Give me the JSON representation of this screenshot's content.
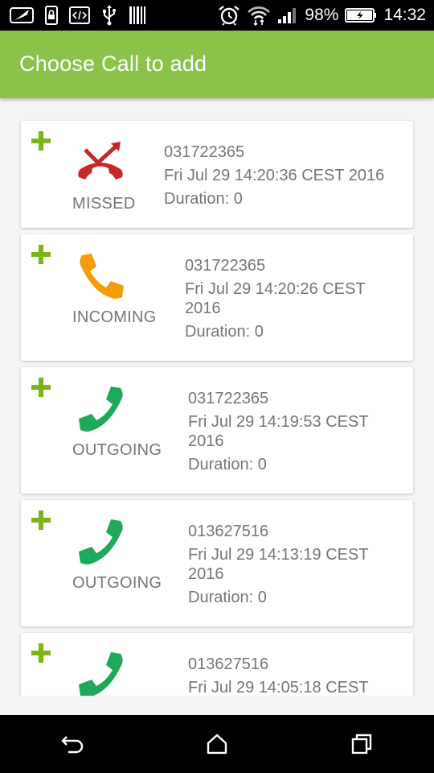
{
  "status_bar": {
    "battery": "98%",
    "time": "14:32"
  },
  "app_bar": {
    "title": "Choose Call to add"
  },
  "colors": {
    "app_bar": "#8bc34a",
    "add": "#7cb518",
    "missed": "#c62828",
    "incoming": "#f59c0a",
    "outgoing": "#20a85a"
  },
  "calls": [
    {
      "type": "MISSED",
      "icon": "missed-call-icon",
      "number": "031722365",
      "date": "Fri Jul 29 14:20:36 CEST 2016",
      "duration": "Duration: 0"
    },
    {
      "type": "INCOMING",
      "icon": "incoming-call-icon",
      "number": "031722365",
      "date": "Fri Jul 29 14:20:26 CEST 2016",
      "duration": "Duration: 0"
    },
    {
      "type": "OUTGOING",
      "icon": "outgoing-call-icon",
      "number": "031722365",
      "date": "Fri Jul 29 14:19:53 CEST 2016",
      "duration": "Duration: 0"
    },
    {
      "type": "OUTGOING",
      "icon": "outgoing-call-icon",
      "number": "013627516",
      "date": "Fri Jul 29 14:13:19 CEST 2016",
      "duration": "Duration: 0"
    },
    {
      "type": "",
      "icon": "outgoing-call-icon",
      "number": "013627516",
      "date": "Fri Jul 29 14:05:18 CEST",
      "duration": ""
    }
  ]
}
